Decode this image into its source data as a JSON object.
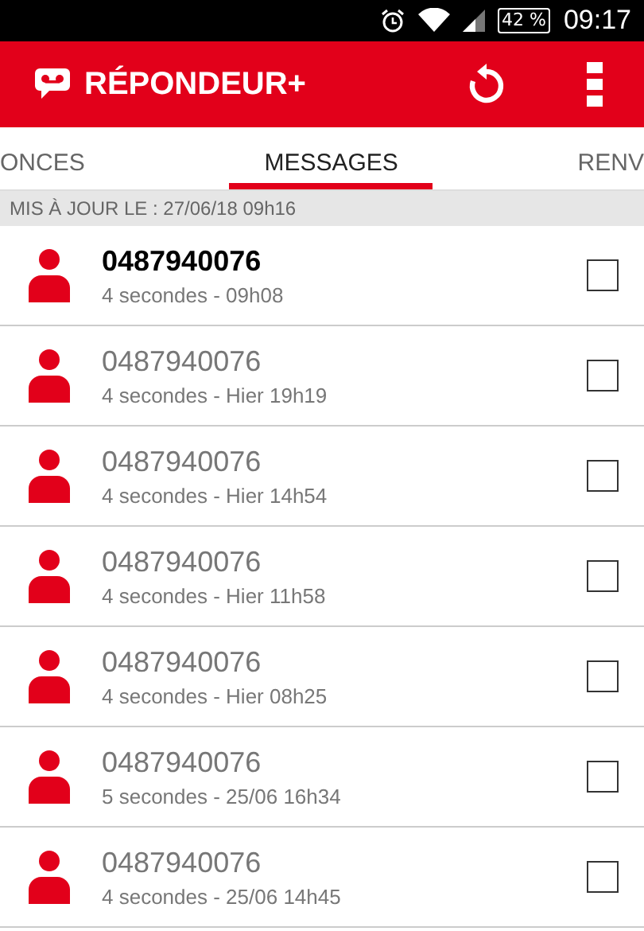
{
  "status_bar": {
    "battery": "42 %",
    "time": "09:17"
  },
  "app_bar": {
    "title": "RÉPONDEUR+"
  },
  "tabs": [
    {
      "label": "ONCES",
      "selected": false
    },
    {
      "label": "MESSAGES",
      "selected": true
    },
    {
      "label": "RENV",
      "selected": false
    }
  ],
  "updated": "MIS À JOUR LE : 27/06/18 09h16",
  "messages": [
    {
      "number": "0487940076",
      "detail": "4 secondes - 09h08",
      "unread": true,
      "checked": false
    },
    {
      "number": "0487940076",
      "detail": "4 secondes - Hier 19h19",
      "unread": false,
      "checked": false
    },
    {
      "number": "0487940076",
      "detail": "4 secondes - Hier 14h54",
      "unread": false,
      "checked": false
    },
    {
      "number": "0487940076",
      "detail": "4 secondes - Hier 11h58",
      "unread": false,
      "checked": false
    },
    {
      "number": "0487940076",
      "detail": "4 secondes - Hier 08h25",
      "unread": false,
      "checked": false
    },
    {
      "number": "0487940076",
      "detail": "5 secondes - 25/06 16h34",
      "unread": false,
      "checked": false
    },
    {
      "number": "0487940076",
      "detail": "4 secondes - 25/06 14h45",
      "unread": false,
      "checked": false
    }
  ]
}
